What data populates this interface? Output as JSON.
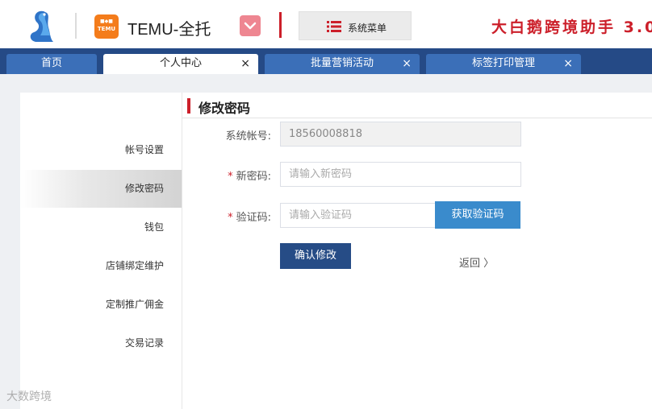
{
  "header": {
    "logo_icon": "swan-logo-icon",
    "temu_logo": {
      "line1": "■◆■",
      "line2": "TEMU"
    },
    "brand_name": "TEMU-全托",
    "dropdown_icon": "chevron-down-icon",
    "menu_icon": "list-menu-icon",
    "menu_label": "系统菜单",
    "app_title": "大白鹅跨境助手 3.0",
    "colors": {
      "accent_red": "#cc1f2a",
      "temu_orange": "#f47c1b"
    }
  },
  "tabs": [
    {
      "label": "首页",
      "closable": false,
      "active": false
    },
    {
      "label": "个人中心",
      "closable": true,
      "active": true,
      "close": "×"
    },
    {
      "label": "批量营销活动",
      "closable": true,
      "active": false,
      "close": "×"
    },
    {
      "label": "标签打印管理",
      "closable": true,
      "active": false,
      "close": "×"
    }
  ],
  "sidebar": {
    "items": [
      {
        "label": "帐号设置"
      },
      {
        "label": "修改密码",
        "active": true
      },
      {
        "label": "钱包"
      },
      {
        "label": "店铺绑定维护"
      },
      {
        "label": "定制推广佣金"
      },
      {
        "label": "交易记录"
      }
    ]
  },
  "panel": {
    "title": "修改密码",
    "fields": {
      "account": {
        "label": "系统帐号:",
        "value": "18560008818"
      },
      "new_password": {
        "required_mark": "*",
        "label": "新密码:",
        "placeholder": "请输入新密码"
      },
      "code": {
        "required_mark": "*",
        "label": "验证码:",
        "placeholder": "请输入验证码"
      }
    },
    "get_code_button": "获取验证码",
    "confirm_button": "确认修改",
    "back_link": "返回 〉"
  },
  "watermark": "大数跨境"
}
